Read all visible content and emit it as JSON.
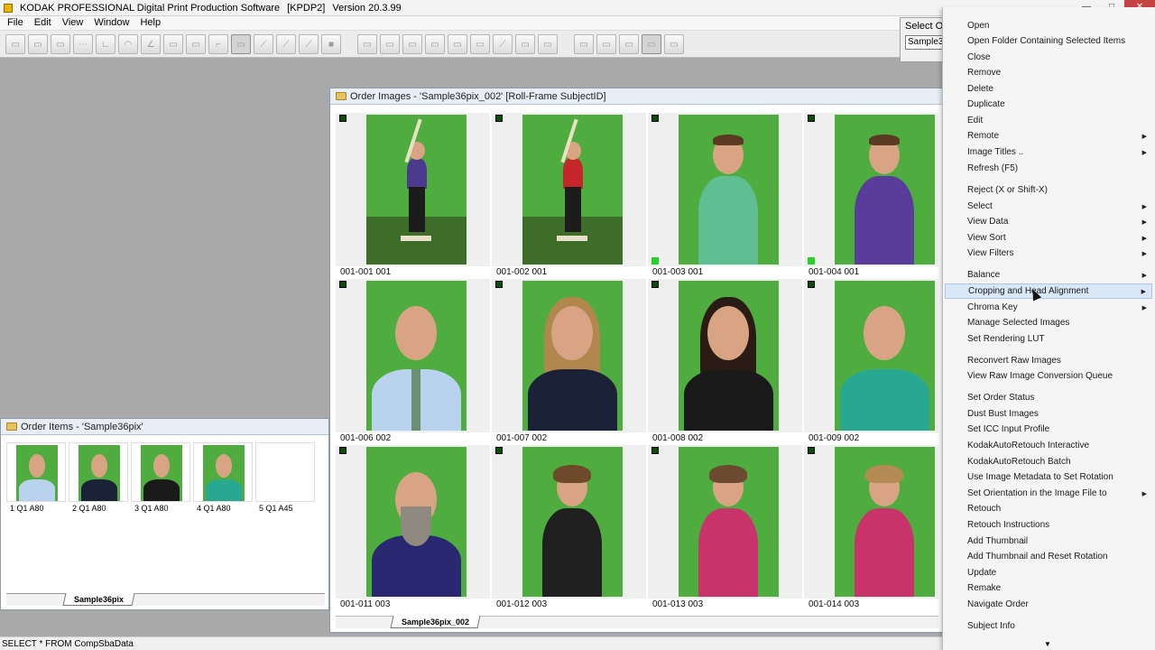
{
  "titlebar": {
    "app_title": "KODAK PROFESSIONAL Digital Print Production Software",
    "tag": "[KPDP2]",
    "version": "Version 20.3.99"
  },
  "menubar": [
    "File",
    "Edit",
    "View",
    "Window",
    "Help"
  ],
  "select_order": {
    "label": "Select Or",
    "value": "Sample36"
  },
  "order_images_window": {
    "title": "Order Images - 'Sample36pix_002'  [Roll-Frame  SubjectID]",
    "tab": "Sample36pix_002",
    "cells": [
      {
        "caption": "001-001  001",
        "subject": "batter-blue"
      },
      {
        "caption": "001-002  001",
        "subject": "batter-red"
      },
      {
        "caption": "001-003  001",
        "subject": "boy-teal"
      },
      {
        "caption": "001-004  001",
        "subject": "boy-purple"
      },
      {
        "caption": "001-006  002",
        "subject": "man-shirt-tie"
      },
      {
        "caption": "001-007  002",
        "subject": "woman-navy"
      },
      {
        "caption": "001-008  002",
        "subject": "woman-black"
      },
      {
        "caption": "001-009  002",
        "subject": "man-teal"
      },
      {
        "caption": "001-011  003",
        "subject": "man-beard"
      },
      {
        "caption": "001-012  003",
        "subject": "girl-stripes"
      },
      {
        "caption": "001-013  003",
        "subject": "girl-pink-stripes"
      },
      {
        "caption": "001-014  003",
        "subject": "girl-pink-stripes-2"
      }
    ]
  },
  "order_items_window": {
    "title": "Order Items - 'Sample36pix'",
    "tab": "Sample36pix",
    "items": [
      {
        "caption": "1 Q1   A80"
      },
      {
        "caption": "2 Q1   A80"
      },
      {
        "caption": "3 Q1   A80"
      },
      {
        "caption": "4 Q1   A80"
      },
      {
        "caption": "5 Q1   A45"
      }
    ]
  },
  "statusbar": "SELECT * FROM CompSbaData",
  "context_menu": [
    {
      "label": "Open",
      "submenu": false
    },
    {
      "label": "Open Folder Containing Selected Items",
      "submenu": false
    },
    {
      "label": "Close",
      "submenu": false
    },
    {
      "label": "Remove",
      "submenu": false
    },
    {
      "label": "Delete",
      "submenu": false
    },
    {
      "label": "Duplicate",
      "submenu": false
    },
    {
      "label": "Edit",
      "submenu": false
    },
    {
      "label": "Remote",
      "submenu": true
    },
    {
      "label": "Image Titles ..",
      "submenu": true
    },
    {
      "label": "Refresh  (F5)",
      "submenu": false
    },
    {
      "label": "Reject (X or Shift-X)",
      "submenu": false
    },
    {
      "label": "Select",
      "submenu": true
    },
    {
      "label": "View Data",
      "submenu": true
    },
    {
      "label": "View Sort",
      "submenu": true
    },
    {
      "label": "View Filters",
      "submenu": true
    },
    {
      "label": "Balance",
      "submenu": true
    },
    {
      "label": "Cropping and Head Alignment",
      "submenu": true,
      "highlighted": true
    },
    {
      "label": "Chroma Key",
      "submenu": true
    },
    {
      "label": "Manage Selected Images",
      "submenu": false
    },
    {
      "label": "Set Rendering LUT",
      "submenu": false
    },
    {
      "label": "Reconvert Raw Images",
      "submenu": false
    },
    {
      "label": "View Raw Image Conversion Queue",
      "submenu": false
    },
    {
      "label": "Set Order Status",
      "submenu": false
    },
    {
      "label": "Dust Bust Images",
      "submenu": false
    },
    {
      "label": "Set ICC Input Profile",
      "submenu": false
    },
    {
      "label": "KodakAutoRetouch Interactive",
      "submenu": false
    },
    {
      "label": "KodakAutoRetouch Batch",
      "submenu": false
    },
    {
      "label": "Use Image Metadata to Set Rotation",
      "submenu": false
    },
    {
      "label": "Set Orientation in the Image File to",
      "submenu": true
    },
    {
      "label": "Retouch",
      "submenu": false
    },
    {
      "label": "Retouch Instructions",
      "submenu": false
    },
    {
      "label": "Add Thumbnail",
      "submenu": false
    },
    {
      "label": "Add Thumbnail and Reset Rotation",
      "submenu": false
    },
    {
      "label": "Update",
      "submenu": false
    },
    {
      "label": "Remake",
      "submenu": false
    },
    {
      "label": "Navigate Order",
      "submenu": false
    },
    {
      "label": "Subject Info",
      "submenu": false
    }
  ],
  "colors": {
    "greenscreen": "#4fad3f",
    "menu_highlight": "#d9e7f7",
    "window_title": "#e8eef5"
  }
}
